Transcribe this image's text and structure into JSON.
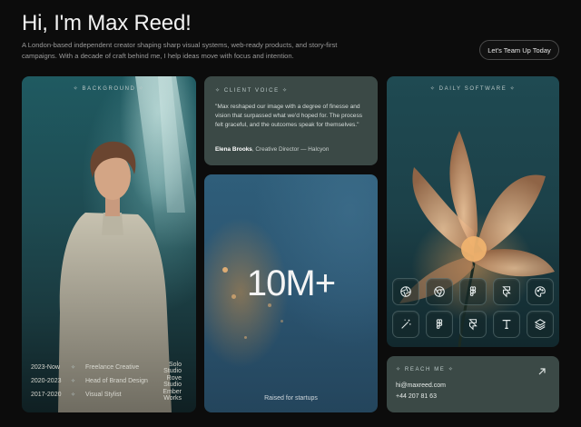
{
  "hero": {
    "title": "Hi, I'm Max Reed!",
    "subtitle": "A London-based independent creator shaping sharp visual systems, web-ready products, and story-first campaigns. With a decade of craft behind me, I help ideas move with focus and intention.",
    "cta_label": "Let's Team Up Today"
  },
  "background": {
    "label": "BACKGROUND",
    "timeline": [
      {
        "years": "2023-Now",
        "role": "Freelance Creative",
        "company": "Solo Studio"
      },
      {
        "years": "2020-2023",
        "role": "Head of Brand Design",
        "company": "Rove Studio"
      },
      {
        "years": "2017-2020",
        "role": "Visual Stylist",
        "company": "Ember Works"
      }
    ]
  },
  "client_voice": {
    "label": "CLIENT VOICE",
    "quote": "\"Max reshaped our image with a degree of finesse and vision that surpassed what we'd hoped for. The process felt graceful, and the outcomes speak for themselves.\"",
    "author_name": "Elena Brooks",
    "author_title": ", Creative Director — Halcyon"
  },
  "stats": {
    "value": "10M+",
    "caption": "Raised for startups"
  },
  "daily_software": {
    "label": "DAILY SOFTWARE",
    "tools_row1": [
      "aperture-icon",
      "chrome-icon",
      "figma-icon",
      "framer-icon",
      "palette-icon"
    ],
    "tools_row2": [
      "magic-wand-icon",
      "figma-icon",
      "framer-icon",
      "type-icon",
      "layers-icon"
    ]
  },
  "reach_me": {
    "label": "REACH ME",
    "email": "hi@maxreed.com",
    "phone": "+44 207 81 63"
  },
  "colors": {
    "page_bg": "#0c0c0c",
    "card_slate": "#3b4946",
    "accent_teal": "#1f5a61"
  }
}
